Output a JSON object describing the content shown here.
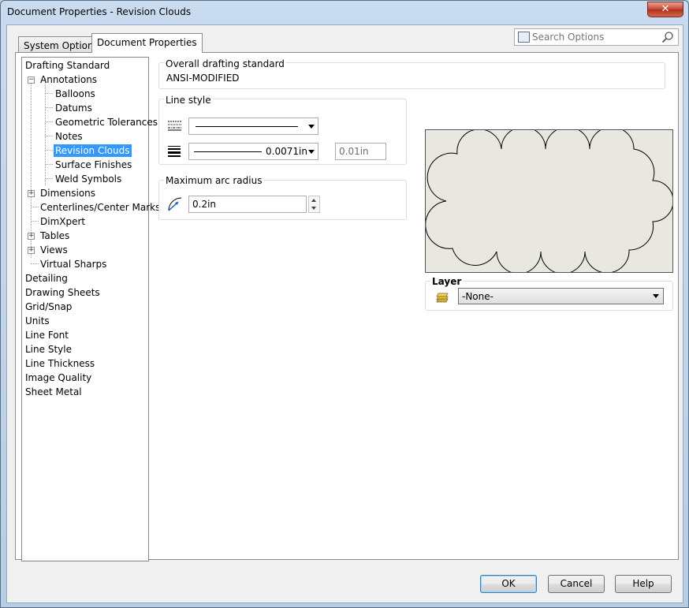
{
  "window": {
    "title": "Document Properties - Revision Clouds",
    "close_label": "✕"
  },
  "tabs": {
    "system": "System Options",
    "document": "Document Properties"
  },
  "search": {
    "placeholder": "Search Options"
  },
  "tree": {
    "drafting_standard": "Drafting Standard",
    "annotations": "Annotations",
    "balloons": "Balloons",
    "datums": "Datums",
    "geometric_tolerances": "Geometric Tolerances",
    "notes": "Notes",
    "revision_clouds": "Revision Clouds",
    "surface_finishes": "Surface Finishes",
    "weld_symbols": "Weld Symbols",
    "dimensions": "Dimensions",
    "centerlines": "Centerlines/Center Marks",
    "dimxpert": "DimXpert",
    "tables": "Tables",
    "views": "Views",
    "virtual_sharps": "Virtual Sharps",
    "detailing": "Detailing",
    "drawing_sheets": "Drawing Sheets",
    "grid_snap": "Grid/Snap",
    "units": "Units",
    "line_font": "Line Font",
    "line_style": "Line Style",
    "line_thickness": "Line Thickness",
    "image_quality": "Image Quality",
    "sheet_metal": "Sheet Metal"
  },
  "overall": {
    "label": "Overall drafting standard",
    "value": "ANSI-MODIFIED"
  },
  "line_style": {
    "label": "Line style",
    "thickness_value": "0.0071in",
    "custom_thickness": "0.01in"
  },
  "arc": {
    "label": "Maximum arc radius",
    "value": "0.2in"
  },
  "layer": {
    "label": "Layer",
    "value": "-None-"
  },
  "buttons": {
    "ok": "OK",
    "cancel": "Cancel",
    "help": "Help"
  }
}
